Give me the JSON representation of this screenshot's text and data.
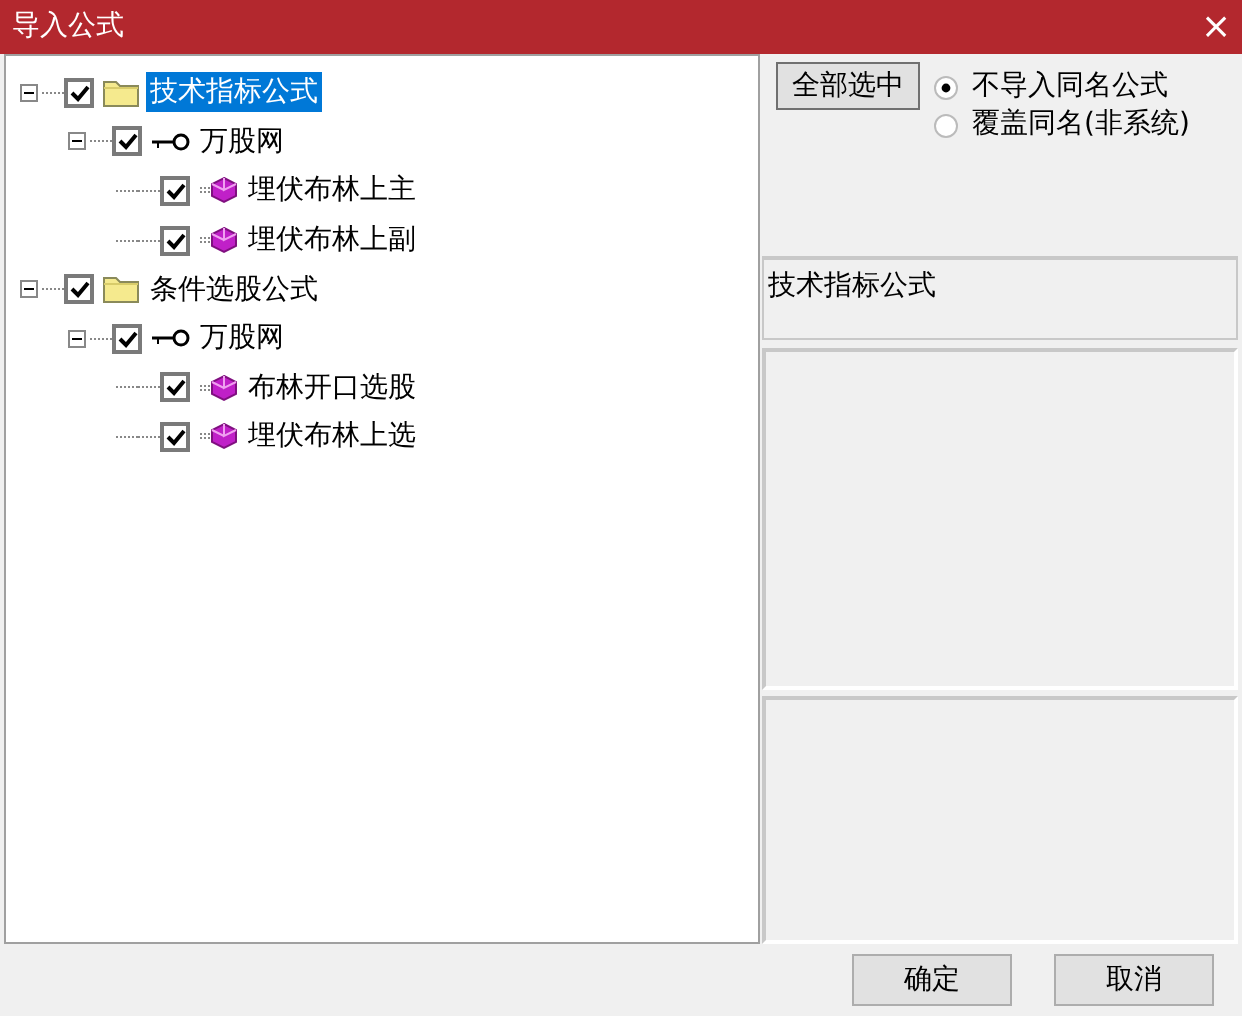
{
  "window": {
    "title": "导入公式",
    "close": "×"
  },
  "tree": [
    {
      "label": "技术指标公式",
      "kind": "folder",
      "checked": true,
      "expanded": true,
      "selected": true,
      "children": [
        {
          "label": "万股网",
          "kind": "group",
          "checked": true,
          "expanded": true,
          "selected": false,
          "children": [
            {
              "label": "埋伏布林上主",
              "kind": "formula",
              "checked": true,
              "selected": false
            },
            {
              "label": "埋伏布林上副",
              "kind": "formula",
              "checked": true,
              "selected": false
            }
          ]
        }
      ]
    },
    {
      "label": "条件选股公式",
      "kind": "folder",
      "checked": true,
      "expanded": true,
      "selected": false,
      "children": [
        {
          "label": "万股网",
          "kind": "group",
          "checked": true,
          "expanded": true,
          "selected": false,
          "children": [
            {
              "label": "布林开口选股",
              "kind": "formula",
              "checked": true,
              "selected": false
            },
            {
              "label": "埋伏布林上选",
              "kind": "formula",
              "checked": true,
              "selected": false
            }
          ]
        }
      ]
    }
  ],
  "select_all_button": "全部选中",
  "options": [
    {
      "label": "不导入同名公式",
      "selected": true
    },
    {
      "label": "覆盖同名(非系统)",
      "selected": false
    }
  ],
  "info_label": "技术指标公式",
  "buttons": [
    "确定",
    "取消"
  ]
}
